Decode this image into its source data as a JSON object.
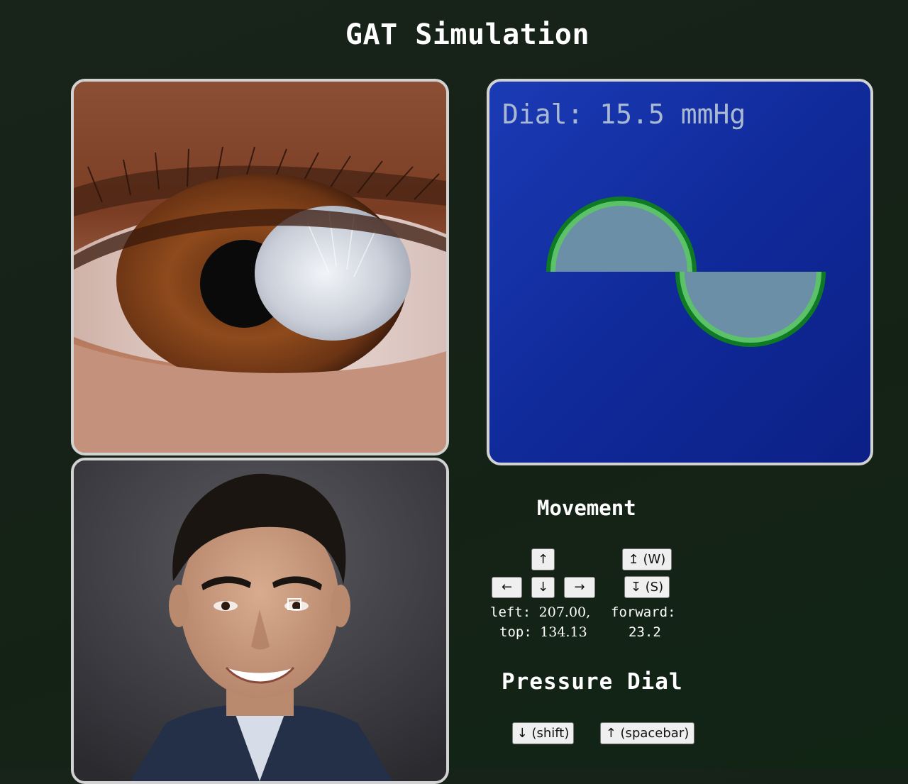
{
  "page": {
    "title": "GAT Simulation"
  },
  "tonometer": {
    "dial_label": "Dial:",
    "dial_value": "15.5",
    "dial_unit": "mmHg"
  },
  "movement": {
    "heading": "Movement",
    "buttons": {
      "up": "↑",
      "left": "←",
      "down": "↓",
      "right": "→",
      "forward": "↥ (W)",
      "backward": "↧ (S)"
    },
    "position": {
      "left_label": "left:",
      "left_value": "207.00,",
      "top_label": "top:",
      "top_value": "134.13",
      "forward_label": "forward:",
      "forward_value": "23.2"
    }
  },
  "pressure": {
    "heading": "Pressure Dial",
    "decrease_label": "↓ (shift)",
    "increase_label": "↑ (spacebar)"
  },
  "colors": {
    "background": "#152216",
    "panel_border": "#d2d2d2",
    "tonometer_bg": "#102a9a",
    "mire_fill": "#6c8fa8",
    "mire_ring_dark": "#0e7a23",
    "mire_ring_light": "#5cc26a"
  }
}
